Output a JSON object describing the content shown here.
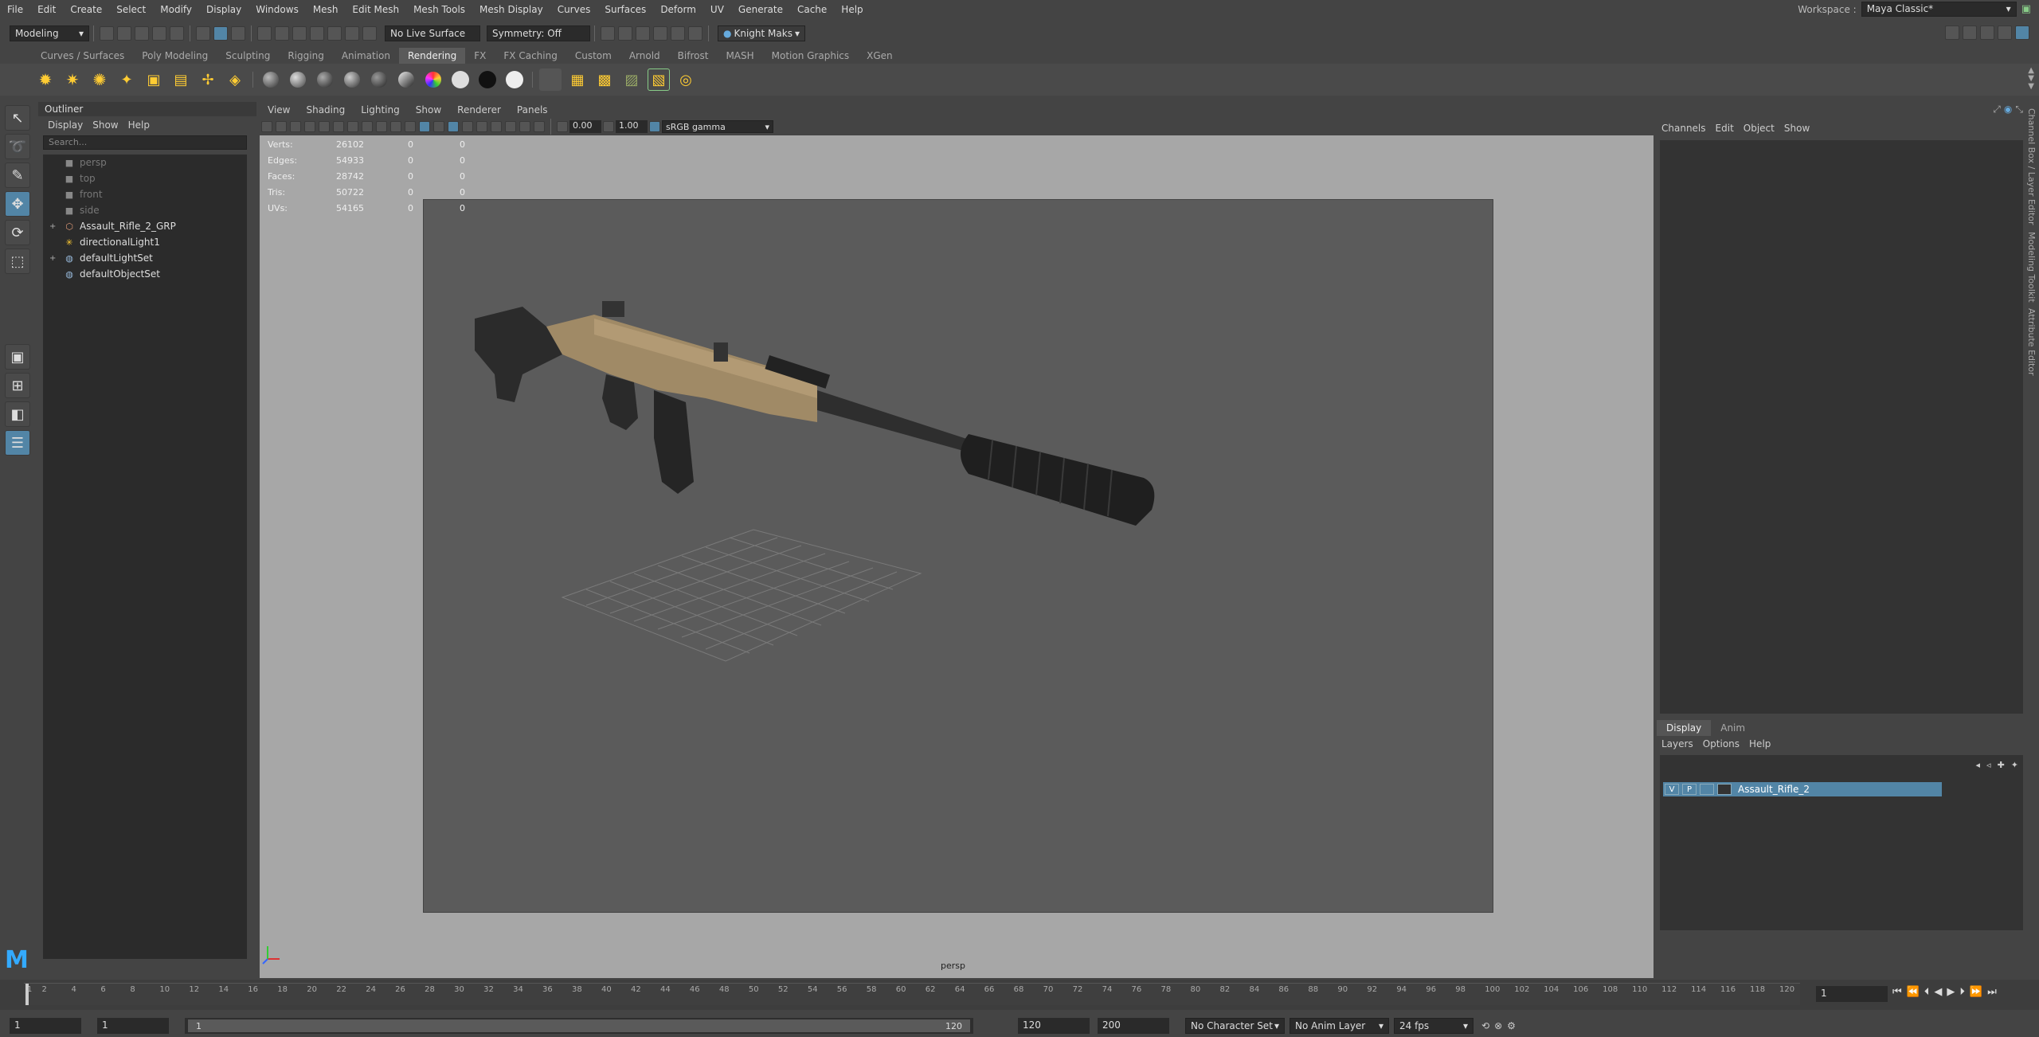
{
  "menubar": {
    "items": [
      "File",
      "Edit",
      "Create",
      "Select",
      "Modify",
      "Display",
      "Windows",
      "Mesh",
      "Edit Mesh",
      "Mesh Tools",
      "Mesh Display",
      "Curves",
      "Surfaces",
      "Deform",
      "UV",
      "Generate",
      "Cache",
      "Help"
    ],
    "workspace_label": "Workspace :",
    "workspace_value": "Maya Classic*"
  },
  "toolbar": {
    "mode": "Modeling",
    "live_surface": "No Live Surface",
    "symmetry": "Symmetry: Off",
    "user": "Knight Maks"
  },
  "shelf": {
    "tabs": [
      "Curves / Surfaces",
      "Poly Modeling",
      "Sculpting",
      "Rigging",
      "Animation",
      "Rendering",
      "FX",
      "FX Caching",
      "Custom",
      "Arnold",
      "Bifrost",
      "MASH",
      "Motion Graphics",
      "XGen"
    ],
    "active_tab": "Rendering"
  },
  "outliner": {
    "title": "Outliner",
    "menu": [
      "Display",
      "Show",
      "Help"
    ],
    "search_placeholder": "Search...",
    "items": [
      {
        "label": "persp",
        "icon": "camera-icon",
        "dim": true,
        "expand": ""
      },
      {
        "label": "top",
        "icon": "camera-icon",
        "dim": true,
        "expand": ""
      },
      {
        "label": "front",
        "icon": "camera-icon",
        "dim": true,
        "expand": ""
      },
      {
        "label": "side",
        "icon": "camera-icon",
        "dim": true,
        "expand": ""
      },
      {
        "label": "Assault_Rifle_2_GRP",
        "icon": "group-icon",
        "dim": false,
        "expand": "+"
      },
      {
        "label": "directionalLight1",
        "icon": "light-icon",
        "dim": false,
        "expand": ""
      },
      {
        "label": "defaultLightSet",
        "icon": "set-icon",
        "dim": false,
        "expand": "+"
      },
      {
        "label": "defaultObjectSet",
        "icon": "set-icon",
        "dim": false,
        "expand": ""
      }
    ]
  },
  "viewport": {
    "menu": [
      "View",
      "Shading",
      "Lighting",
      "Show",
      "Renderer",
      "Panels"
    ],
    "exposure": "0.00",
    "gamma": "1.00",
    "color_space": "sRGB gamma",
    "camera": "persp",
    "hud": [
      {
        "label": "Verts:",
        "a": "26102",
        "b": "0",
        "c": "0"
      },
      {
        "label": "Edges:",
        "a": "54933",
        "b": "0",
        "c": "0"
      },
      {
        "label": "Faces:",
        "a": "28742",
        "b": "0",
        "c": "0"
      },
      {
        "label": "Tris:",
        "a": "50722",
        "b": "0",
        "c": "0"
      },
      {
        "label": "UVs:",
        "a": "54165",
        "b": "0",
        "c": "0"
      }
    ]
  },
  "channelbox": {
    "menu": [
      "Channels",
      "Edit",
      "Object",
      "Show"
    ],
    "side_tabs": [
      "Channel Box / Layer Editor",
      "Modeling Toolkit",
      "Attribute Editor"
    ]
  },
  "layers": {
    "tabs": [
      "Display",
      "Anim"
    ],
    "active_tab": "Display",
    "menu": [
      "Layers",
      "Options",
      "Help"
    ],
    "layer_name": "Assault_Rifle_2",
    "v": "V",
    "p": "P"
  },
  "timeline": {
    "ticks": [
      "1",
      "2",
      "4",
      "6",
      "8",
      "10",
      "12",
      "14",
      "16",
      "18",
      "20",
      "22",
      "24",
      "26",
      "28",
      "30",
      "32",
      "34",
      "36",
      "38",
      "40",
      "42",
      "44",
      "46",
      "48",
      "50",
      "52",
      "54",
      "56",
      "58",
      "60",
      "62",
      "64",
      "66",
      "68",
      "70",
      "72",
      "74",
      "76",
      "78",
      "80",
      "82",
      "84",
      "86",
      "88",
      "90",
      "92",
      "94",
      "96",
      "98",
      "100",
      "102",
      "104",
      "106",
      "108",
      "110",
      "112",
      "114",
      "116",
      "118",
      "120"
    ],
    "current_frame": "1"
  },
  "range": {
    "start": "1",
    "playback_start": "1",
    "slider_left": "1",
    "slider_right": "120",
    "playback_end": "120",
    "end": "200",
    "character_set": "No Character Set",
    "anim_layer": "No Anim Layer",
    "fps": "24 fps"
  },
  "colors": {
    "accent": "#5285a6",
    "viewport_bg": "#a7a7a7",
    "gate_bg": "#5b5b5b"
  }
}
